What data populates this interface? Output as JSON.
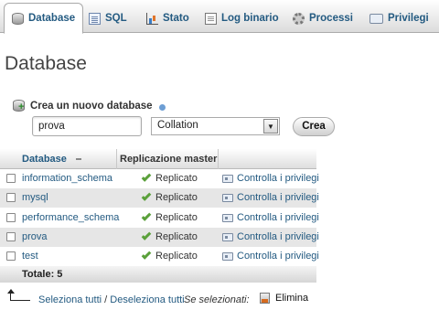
{
  "tabs": [
    {
      "label": "Database",
      "icon": "database-icon",
      "active": true
    },
    {
      "label": "SQL",
      "icon": "sql-icon"
    },
    {
      "label": "Stato",
      "icon": "status-chart-icon"
    },
    {
      "label": "Log binario",
      "icon": "log-icon"
    },
    {
      "label": "Processi",
      "icon": "gear-icon"
    },
    {
      "label": "Privilegi",
      "icon": "privileges-icon"
    }
  ],
  "page_title": "Database",
  "create": {
    "label": "Crea un nuovo database",
    "name_value": "prova",
    "collation_value": "Collation",
    "button_label": "Crea"
  },
  "table": {
    "headers": {
      "database": "Database",
      "replication": "Replicazione master"
    },
    "rows": [
      {
        "name": "information_schema",
        "replication": "Replicato",
        "action": "Controlla i privilegi"
      },
      {
        "name": "mysql",
        "replication": "Replicato",
        "action": "Controlla i privilegi"
      },
      {
        "name": "performance_schema",
        "replication": "Replicato",
        "action": "Controlla i privilegi"
      },
      {
        "name": "prova",
        "replication": "Replicato",
        "action": "Controlla i privilegi"
      },
      {
        "name": "test",
        "replication": "Replicato",
        "action": "Controlla i privilegi"
      }
    ],
    "total": "Totale: 5"
  },
  "footer": {
    "select_all": "Seleziona tutti",
    "separator": "/",
    "deselect_all": "Deseleziona tutti",
    "with_selected": "Se selezionati:",
    "delete_label": "Elimina"
  },
  "colors": {
    "link": "#235a81",
    "even_row": "#e6e6e6",
    "check": "#5aa03a"
  }
}
